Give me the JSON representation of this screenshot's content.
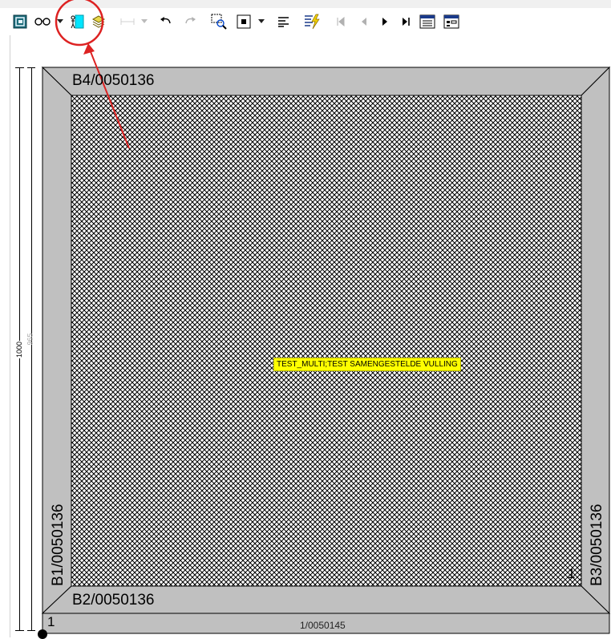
{
  "toolbar": {
    "buttons": [
      {
        "name": "app-icon",
        "disabled": false
      },
      {
        "name": "glasses-icon",
        "disabled": false
      },
      {
        "name": "person-door-icon",
        "disabled": false
      },
      {
        "name": "layers-icon",
        "disabled": false
      },
      {
        "name": "disabled-icon",
        "disabled": true
      },
      {
        "name": "undo-icon",
        "disabled": false
      },
      {
        "name": "redo-icon",
        "disabled": true
      },
      {
        "name": "zoom-select-icon",
        "disabled": false
      },
      {
        "name": "frame-view-icon",
        "disabled": false
      },
      {
        "name": "align-left-icon",
        "disabled": false
      },
      {
        "name": "flash-edit-icon",
        "disabled": false
      },
      {
        "name": "first-page-icon",
        "disabled": true
      },
      {
        "name": "prev-page-icon",
        "disabled": true
      },
      {
        "name": "next-page-icon",
        "disabled": false
      },
      {
        "name": "last-page-icon",
        "disabled": false
      },
      {
        "name": "table-view-icon",
        "disabled": false
      },
      {
        "name": "form-view-icon",
        "disabled": false
      }
    ]
  },
  "annotation": {
    "color": "#dd2222"
  },
  "dimensions": {
    "outer": "1000",
    "inner": "965"
  },
  "pieces": {
    "top": "B4/0050136",
    "left": "B1/0050136",
    "bottom": "B2/0050136",
    "right": "B3/0050136"
  },
  "corner_labels": {
    "bottom_left": "1",
    "inner_bottom_right": "1"
  },
  "bottom_code": "1/0050145",
  "fill_tooltip": "TEST_MULTI;TEST SAMENGESTELDE VULLING",
  "colors": {
    "frame": "#c0c0c0",
    "hatch": "#000000",
    "tooltip_bg": "#ffff00"
  }
}
